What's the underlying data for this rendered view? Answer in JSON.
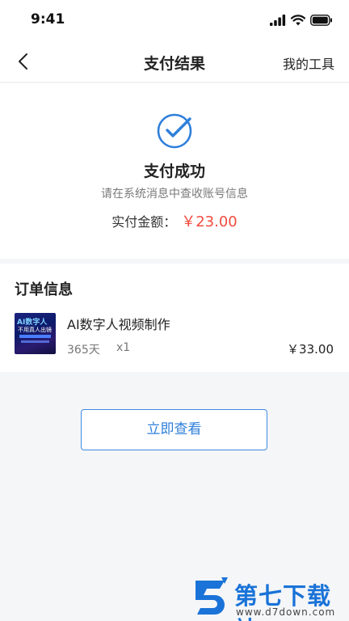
{
  "status_bar": {
    "time": "9:41"
  },
  "nav": {
    "title": "支付结果",
    "right_label": "我的工具"
  },
  "result": {
    "title": "支付成功",
    "subtitle": "请在系统消息中查收账号信息",
    "amount_label": "实付金额：",
    "amount_value": "￥23.00",
    "accent_color": "#2f7fdb",
    "price_color": "#ef4c3e"
  },
  "order": {
    "section_title": "订单信息",
    "item": {
      "thumbnail_text_1": "AI数字人",
      "thumbnail_text_2": "不用真人出镜",
      "name": "AI数字人视频制作",
      "duration": "365天",
      "quantity": "x1",
      "price": "￥33.00"
    }
  },
  "actions": {
    "view_label": "立即查看"
  },
  "watermark": {
    "brand": "第七下载站",
    "url": "www.d7down.com"
  }
}
